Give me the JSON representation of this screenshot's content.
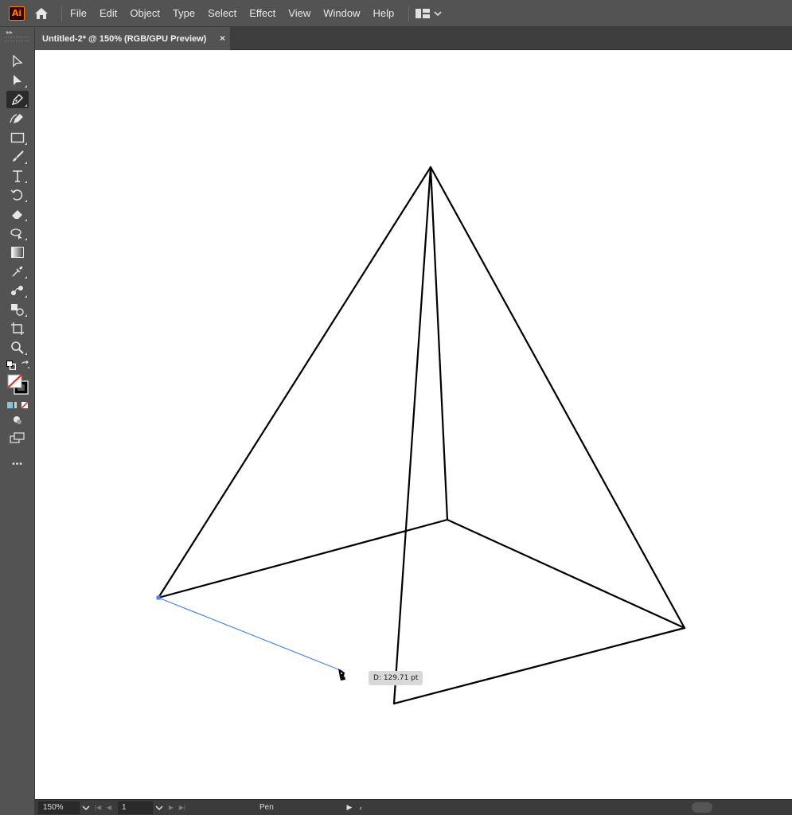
{
  "app": {
    "logo_text": "Ai",
    "accent_color": "#ff7c00"
  },
  "menu": {
    "items": [
      "File",
      "Edit",
      "Object",
      "Type",
      "Select",
      "Effect",
      "View",
      "Window",
      "Help"
    ]
  },
  "document": {
    "tab_title": "Untitled-2* @ 150% (RGB/GPU Preview)",
    "close_glyph": "×"
  },
  "toolbar": {
    "tools": [
      {
        "name": "selection-tool",
        "icon": "arrow-outline-icon"
      },
      {
        "name": "direct-selection-tool",
        "icon": "arrow-filled-icon"
      },
      {
        "name": "pen-tool",
        "icon": "pen-icon",
        "active": true
      },
      {
        "name": "curvature-tool",
        "icon": "curvature-pen-icon"
      },
      {
        "name": "rectangle-tool",
        "icon": "rectangle-icon"
      },
      {
        "name": "paintbrush-tool",
        "icon": "brush-icon"
      },
      {
        "name": "type-tool",
        "icon": "type-icon"
      },
      {
        "name": "rotate-tool",
        "icon": "rotate-icon"
      },
      {
        "name": "eraser-tool",
        "icon": "eraser-icon"
      },
      {
        "name": "puppet-warp-tool",
        "icon": "puppet-warp-icon"
      },
      {
        "name": "gradient-tool",
        "icon": "gradient-icon"
      },
      {
        "name": "eyedropper-tool",
        "icon": "eyedropper-icon"
      },
      {
        "name": "blend-tool",
        "icon": "blend-icon"
      },
      {
        "name": "shape-builder-tool",
        "icon": "shape-builder-icon"
      },
      {
        "name": "artboard-tool",
        "icon": "artboard-icon"
      },
      {
        "name": "zoom-tool",
        "icon": "magnifier-icon"
      }
    ],
    "more_glyph": "•••",
    "colors": {
      "fill": "none",
      "stroke": "#000000"
    }
  },
  "canvas": {
    "distance_tooltip": "D: 129.71 pt",
    "path_color": "#000000",
    "preview_line_color": "#4a86f0"
  },
  "status": {
    "zoom": "150%",
    "page": "1",
    "current_tool": "Pen"
  }
}
